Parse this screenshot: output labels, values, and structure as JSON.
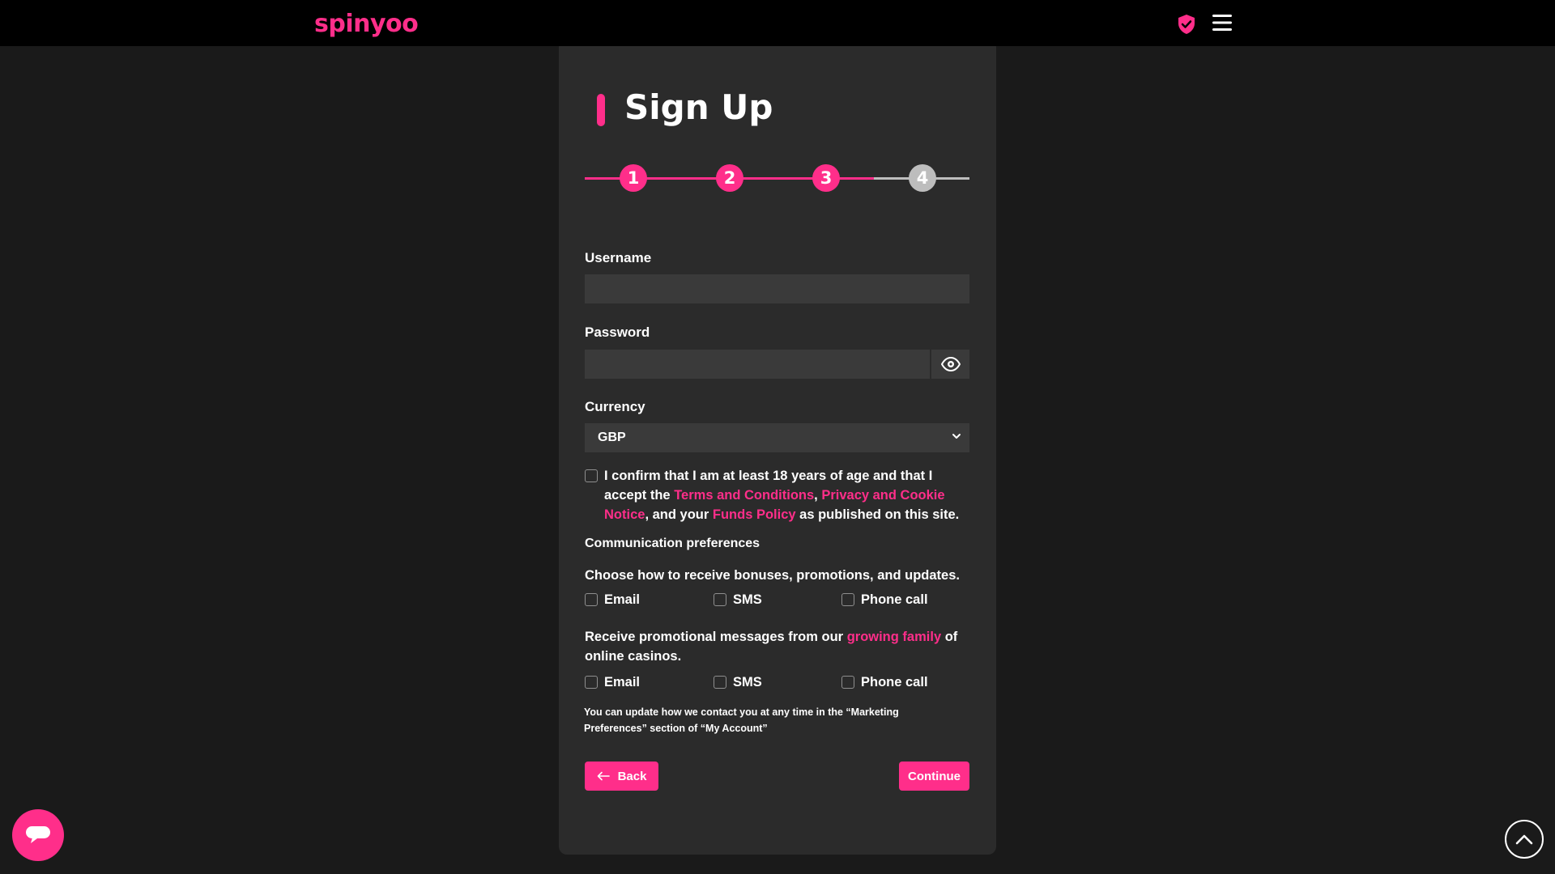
{
  "header": {
    "logo_text": "spinyoo",
    "shield_icon": "shield-check-icon",
    "menu_icon": "hamburger-menu-icon"
  },
  "colors": {
    "accent": "#ff2e8a",
    "background": "#1a1a1a",
    "card": "#2b2b2b",
    "input": "#3a3a3a",
    "step_inactive": "#bdbdbd"
  },
  "form": {
    "title": "Sign Up",
    "steps": [
      "1",
      "2",
      "3",
      "4"
    ],
    "current_step": 4,
    "username_label": "Username",
    "username_value": "",
    "password_label": "Password",
    "password_value": "",
    "password_toggle_icon": "eye-icon",
    "currency_label": "Currency",
    "currency_value": "GBP",
    "terms": {
      "part1": "I confirm that I am at least 18 years of age and that I accept the ",
      "terms_link": "Terms and Conditions",
      "sep": ", ",
      "privacy_link": "Privacy and Cookie Notice",
      "part2": ", and your ",
      "funds_link": "Funds Policy",
      "part3": " as published on this site."
    },
    "comm_heading": "Communication preferences",
    "comm_desc": "Choose how to receive bonuses, promotions, and updates.",
    "comm_options": [
      "Email",
      "SMS",
      "Phone call"
    ],
    "promo": {
      "part1": "Receive promotional messages from our ",
      "link": "growing family",
      "part2": " of online casinos."
    },
    "promo_options": [
      "Email",
      "SMS",
      "Phone call"
    ],
    "note": "You can update how we contact you at any time in the “Marketing Preferences” section of “My Account”",
    "back_label": "Back",
    "back_icon": "arrow-left-icon",
    "continue_label": "Continue"
  },
  "floating": {
    "chat_icon": "chat-bubble-icon",
    "scroll_top_icon": "chevron-up-icon"
  }
}
